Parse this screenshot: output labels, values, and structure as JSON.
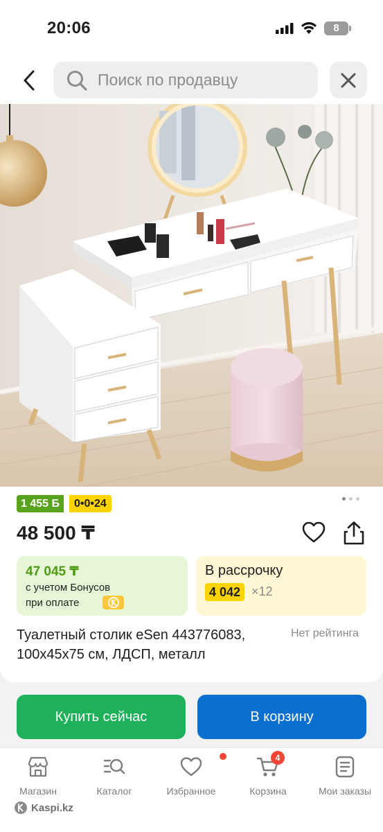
{
  "status_bar": {
    "time": "20:06",
    "battery": "8"
  },
  "header": {
    "search_placeholder": "Поиск по продавцу"
  },
  "product": {
    "bonus_badge": "1 455 Б",
    "installment_badge": "0•0•24",
    "price": "48 500 ₸",
    "bonus_price": "47 045 ₸",
    "bonus_line1": "с учетом Бонусов",
    "bonus_line2": "при оплате",
    "credit_title": "В рассрочку",
    "credit_amount": "4 042",
    "credit_months": "×12",
    "title": "Туалетный столик eSen 443776083, 100x45x75 см, ЛДСП, металл",
    "rating": "Нет рейтинга"
  },
  "actions": {
    "buy_now": "Купить сейчас",
    "add_to_cart": "В корзину"
  },
  "nav": {
    "items": [
      {
        "label": "Магазин",
        "icon": "shop-icon"
      },
      {
        "label": "Каталог",
        "icon": "catalog-icon"
      },
      {
        "label": "Избранное",
        "icon": "heart-icon"
      },
      {
        "label": "Корзина",
        "icon": "cart-icon",
        "badge": "4"
      },
      {
        "label": "Мои заказы",
        "icon": "orders-icon"
      }
    ],
    "brand": "Kaspi.kz"
  },
  "colors": {
    "accent_green": "#1fb15a",
    "accent_blue": "#0b6fd0",
    "bonus_green": "#5aa31c",
    "badge_yellow": "#ffd400",
    "notification_red": "#f14635"
  }
}
